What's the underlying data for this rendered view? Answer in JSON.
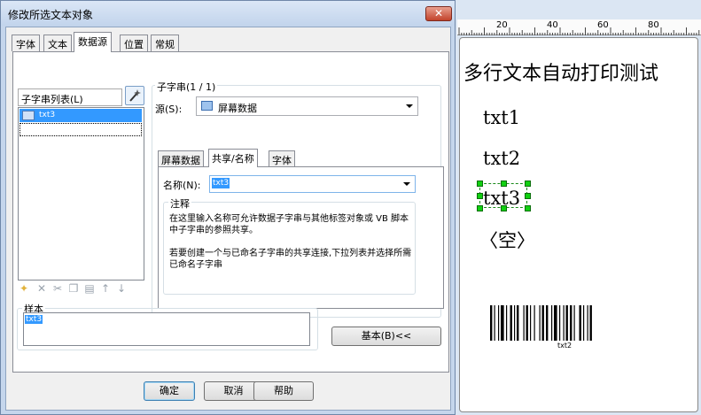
{
  "dialog": {
    "title": "修改所选文本对象",
    "close_label": "✕",
    "tabs": [
      "字体",
      "文本",
      "数据源",
      "位置",
      "常规"
    ],
    "active_tab": "数据源"
  },
  "substring_list": {
    "label": "子字串列表(L)",
    "items": [
      "txt3"
    ]
  },
  "substring_group": {
    "title": "子字串(1 / 1)",
    "source_label": "源(S):",
    "source_value": "屏幕数据",
    "inner_tabs": [
      "屏幕数据",
      "共享/名称",
      "字体"
    ],
    "active_inner_tab": "共享/名称",
    "name_label": "名称(N):",
    "name_value": "txt3",
    "note_title": "注释",
    "note_p1": "在这里输入名称可允许数据子字串与其他标签对象或 VB 脚本中子字串的参照共享。",
    "note_p2": "若要创建一个与已命名子字串的共享连接,下拉列表并选择所需已命名子字串"
  },
  "sample": {
    "title": "样本",
    "value": "txt3"
  },
  "buttons": {
    "basic": "基本(B)<<",
    "ok": "确定",
    "cancel": "取消",
    "help": "帮助"
  },
  "ruler": {
    "marks": [
      "20",
      "40",
      "60",
      "80"
    ]
  },
  "label_canvas": {
    "heading": "多行文本自动打印测试",
    "lines": [
      "txt1",
      "txt2",
      "txt3",
      "〈空〉"
    ],
    "barcode_caption": "txt2"
  }
}
